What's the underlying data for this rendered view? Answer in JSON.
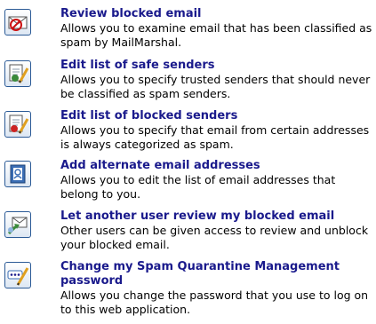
{
  "menu": {
    "items": [
      {
        "title": "Review blocked email",
        "description": "Allows you to examine email that has been classified as spam by MailMarshal.",
        "icon": "blocked-envelope-icon"
      },
      {
        "title": "Edit list of safe senders",
        "description": "Allows you to specify trusted senders that should never be classified as spam senders.",
        "icon": "safe-senders-list-edit-icon"
      },
      {
        "title": "Edit list of blocked senders",
        "description": "Allows you to specify that email from certain addresses is always categorized as spam.",
        "icon": "blocked-senders-list-edit-icon"
      },
      {
        "title": "Add alternate email addresses",
        "description": "Allows you to edit the list of email addresses that belong to you.",
        "icon": "address-book-icon"
      },
      {
        "title": "Let another user review my blocked email",
        "description": "Other users can be given access to review and unblock your blocked email.",
        "icon": "delegate-access-icon"
      },
      {
        "title": "Change my Spam Quarantine Management password",
        "description": "Allows you change the password that you use to log on to this web application.",
        "icon": "password-edit-icon"
      }
    ]
  }
}
